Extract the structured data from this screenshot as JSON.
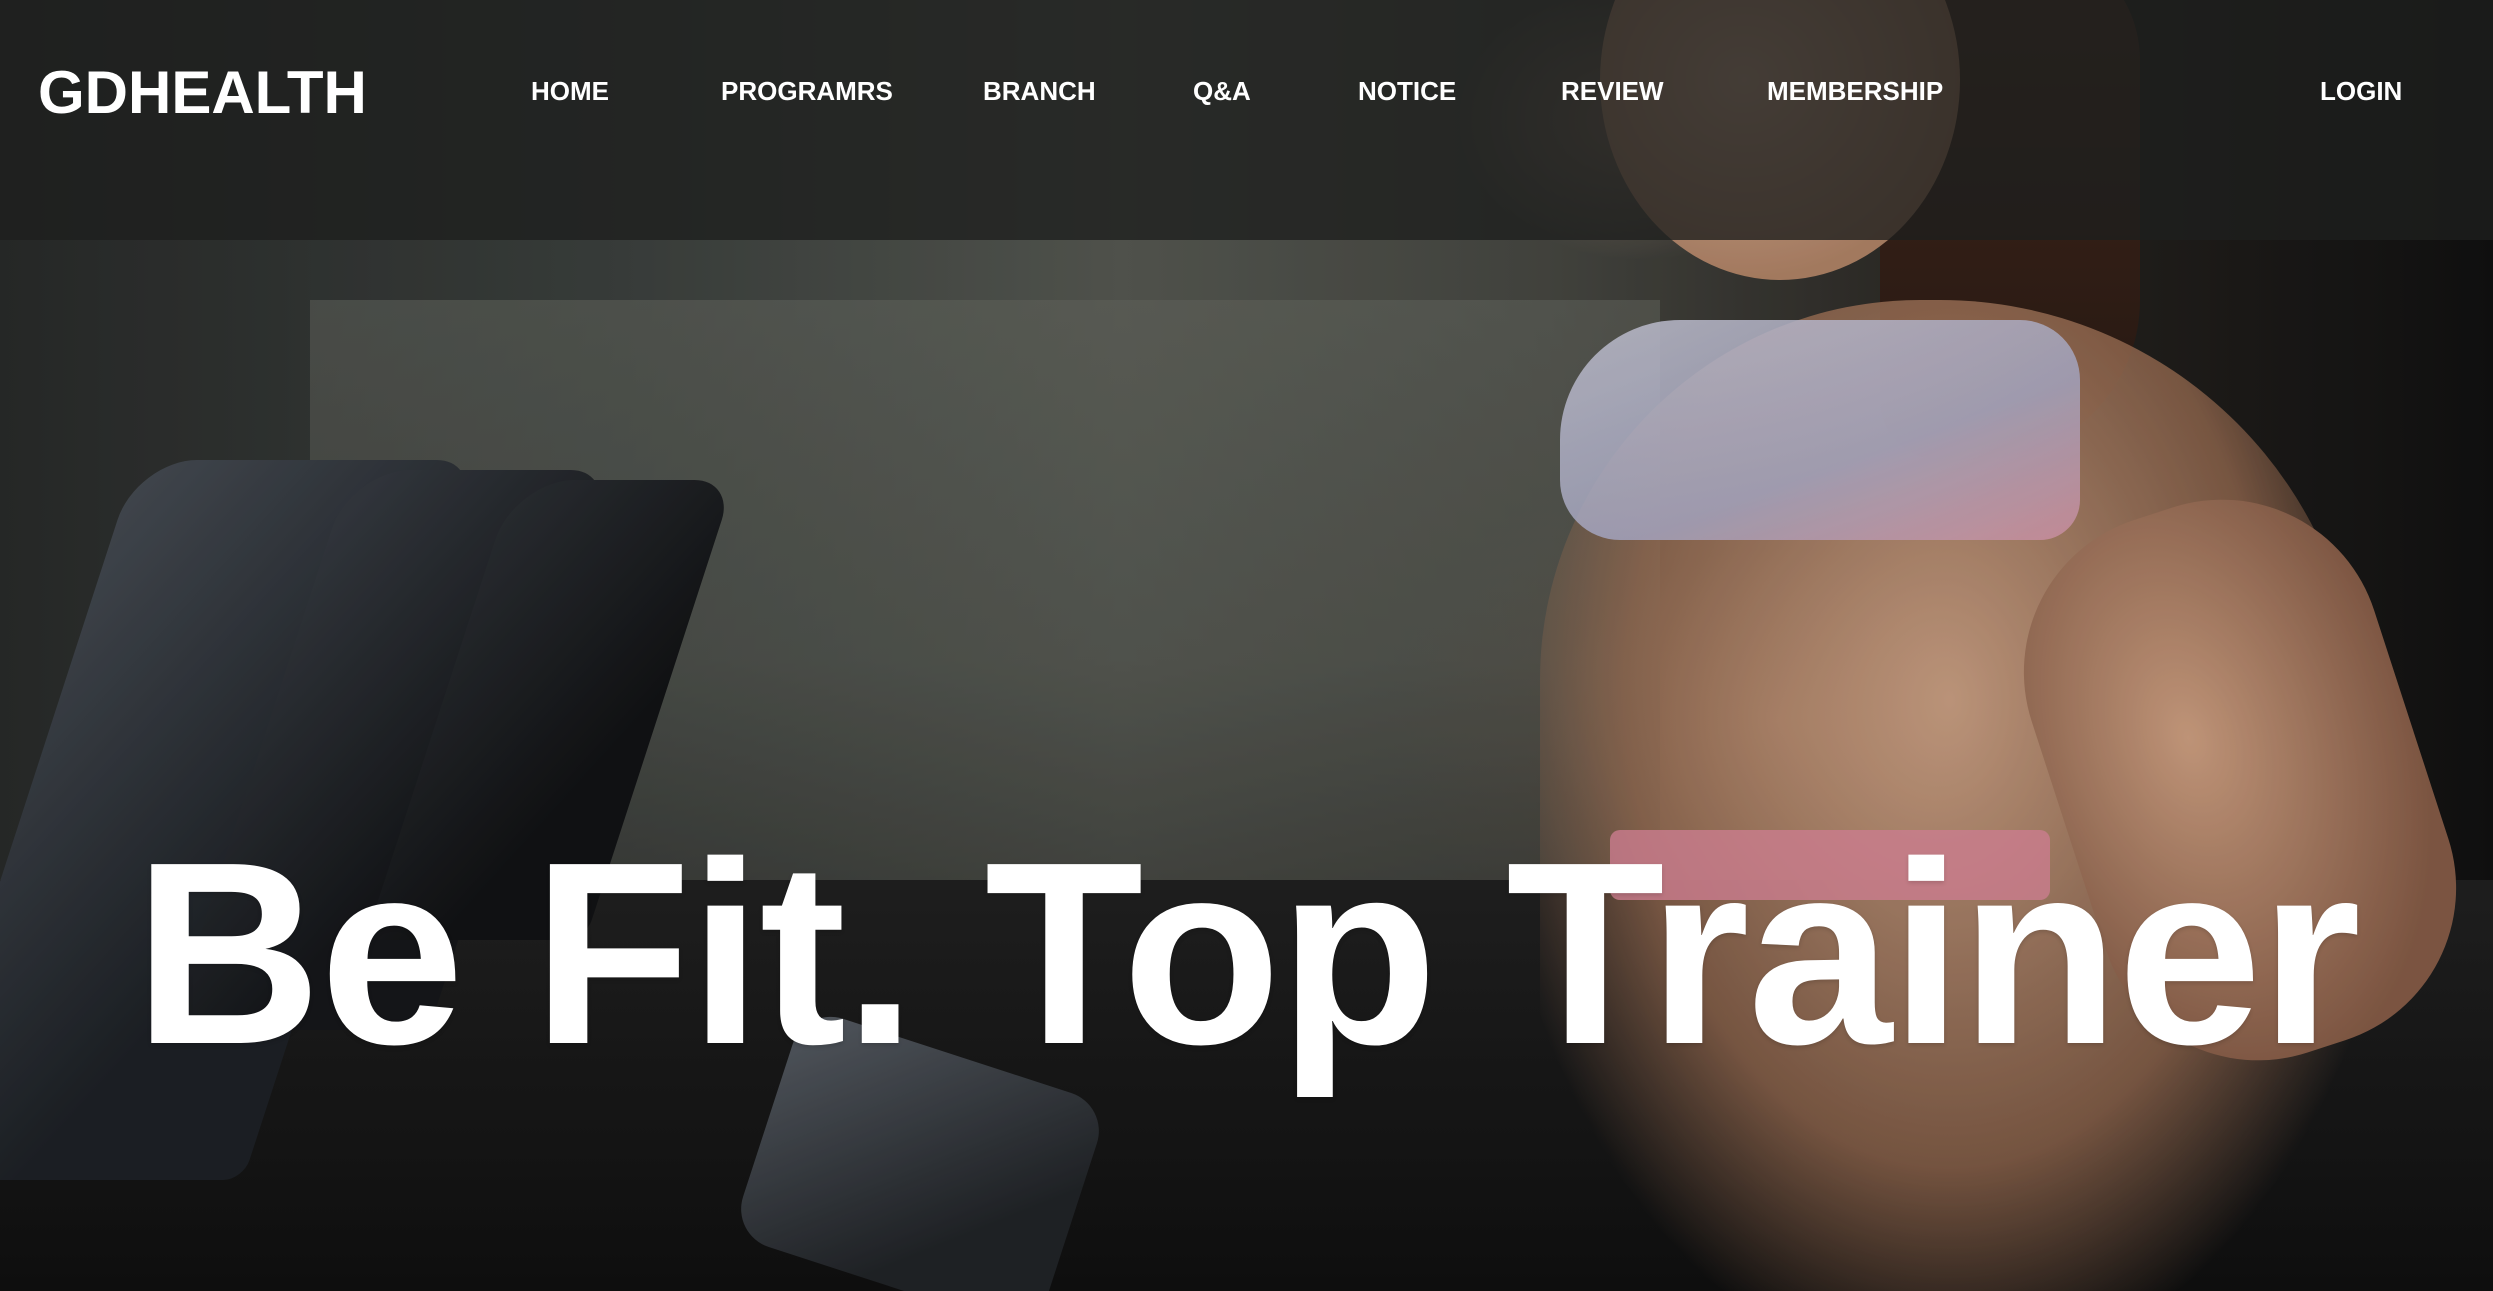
{
  "brand": {
    "logo": "GDHEALTH"
  },
  "nav": {
    "items": [
      {
        "label": "HOME"
      },
      {
        "label": "PROGRAMRS"
      },
      {
        "label": "BRANCH"
      },
      {
        "label": "Q&A"
      },
      {
        "label": "NOTICE"
      },
      {
        "label": "REVIEW"
      },
      {
        "label": "MEMBERSHIP"
      }
    ],
    "login": "LOGIN"
  },
  "hero": {
    "headline": "Be Fit. Top Trainer",
    "background": "gym-treadmill-runner-photo"
  },
  "colors": {
    "header_bg": "#1e1f1e",
    "text": "#ffffff"
  }
}
